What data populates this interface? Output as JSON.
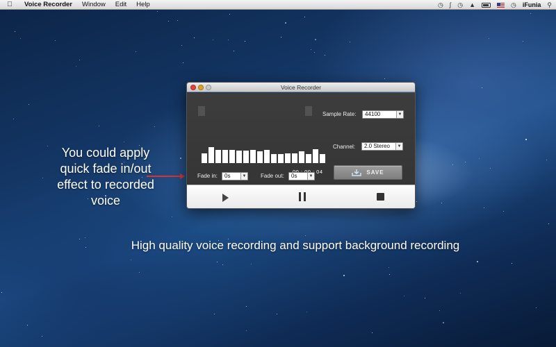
{
  "menubar": {
    "apple_icon": "apple-logo",
    "app_name": "Voice Recorder",
    "menus": [
      "Window",
      "Edit",
      "Help"
    ],
    "status_user": "iFunia"
  },
  "window": {
    "title": "Voice Recorder",
    "timer": "00 : 00 : 04",
    "sample_rate_label": "Sample Rate:",
    "sample_rate_value": "44100",
    "channel_label": "Channel:",
    "channel_value": "2.0 Stereo",
    "save_label": "SAVE",
    "fade_in_label": "Fade in:",
    "fade_in_value": "0s",
    "fade_out_label": "Fade out:",
    "fade_out_value": "0s",
    "waveform_levels": [
      0.6,
      0.95,
      0.8,
      0.8,
      0.8,
      0.75,
      0.75,
      0.8,
      0.7,
      0.8,
      0.55,
      0.55,
      0.6,
      0.6,
      0.7,
      0.55,
      0.85,
      0.55
    ]
  },
  "captions": {
    "left": "You could apply quick fade in/out effect to recorded voice",
    "bottom": "High quality voice recording and support background recording"
  },
  "colors": {
    "arrow": "#d93333",
    "panel": "#3a3a3a",
    "wallpaper": "#143766"
  }
}
